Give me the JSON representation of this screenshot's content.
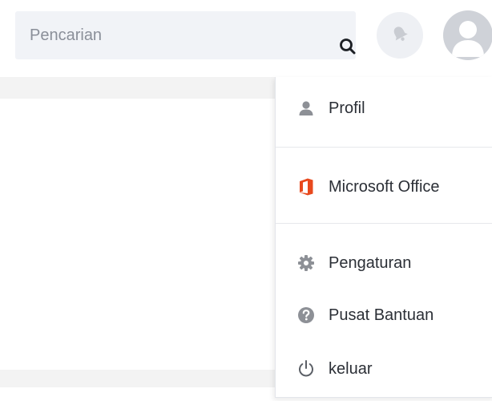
{
  "header": {
    "search": {
      "placeholder": "Pencarian",
      "value": ""
    },
    "icons": {
      "search": "search-icon",
      "notification": "bell-icon",
      "avatar": "user-avatar-icon"
    }
  },
  "dropdown": {
    "items": [
      {
        "label": "Profil",
        "icon": "user-icon"
      },
      {
        "label": "Microsoft Office",
        "icon": "microsoft-office-icon"
      },
      {
        "label": "Pengaturan",
        "icon": "gear-icon"
      },
      {
        "label": "Pusat Bantuan",
        "icon": "help-icon"
      },
      {
        "label": "keluar",
        "icon": "power-icon"
      }
    ]
  },
  "colors": {
    "search_bg": "#f1f3f7",
    "avatar_bg": "#cfd2d8",
    "office_orange": "#e8491d",
    "icon_gray": "#8d9096",
    "text": "#2b2f36"
  }
}
